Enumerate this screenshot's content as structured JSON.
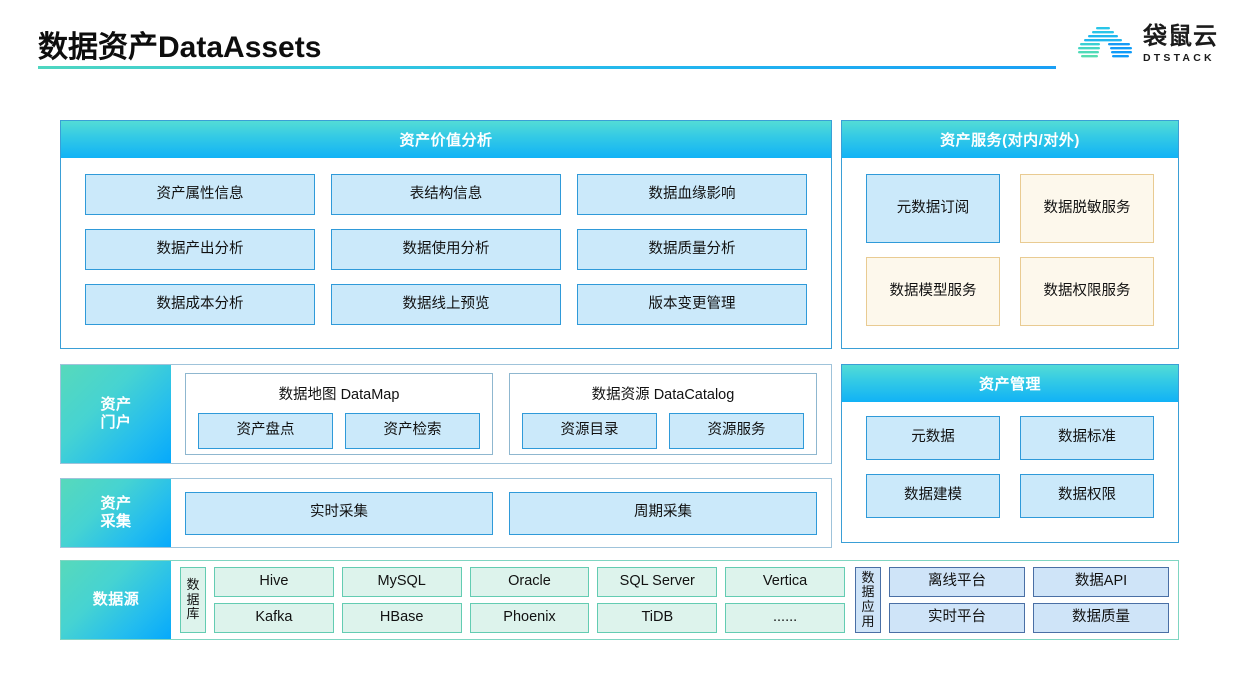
{
  "header": {
    "title": "数据资产DataAssets",
    "logo_cn": "袋鼠云",
    "logo_en": "DTSTACK",
    "logo_icon": "kangaroo-cloud-logo"
  },
  "colors": {
    "header_gradient_start": "#53dcd6",
    "header_gradient_end": "#11b2f6",
    "blue_fill": "#cbe9fa",
    "blue_border": "#2f9ad9",
    "cream_fill": "#fdf8ec",
    "cream_border": "#e9cb92",
    "mint_fill": "#ddf3ec",
    "mint_border": "#63ccb2",
    "app_fill": "#cfe4f8",
    "app_border": "#4a6fa5"
  },
  "value_analysis": {
    "title": "资产价值分析",
    "items": [
      {
        "label": "资产属性信息",
        "style": "blue"
      },
      {
        "label": "表结构信息",
        "style": "blue"
      },
      {
        "label": "数据血缘影响",
        "style": "blue"
      },
      {
        "label": "数据产出分析",
        "style": "blue"
      },
      {
        "label": "数据使用分析",
        "style": "blue"
      },
      {
        "label": "数据质量分析",
        "style": "blue"
      },
      {
        "label": "数据成本分析",
        "style": "blue"
      },
      {
        "label": "数据线上预览",
        "style": "blue"
      },
      {
        "label": "版本变更管理",
        "style": "blue"
      }
    ]
  },
  "asset_service": {
    "title": "资产服务(对内/对外)",
    "items": [
      {
        "label": "元数据订阅",
        "style": "blue"
      },
      {
        "label": "数据脱敏服务",
        "style": "cream"
      },
      {
        "label": "数据模型服务",
        "style": "cream"
      },
      {
        "label": "数据权限服务",
        "style": "cream"
      }
    ]
  },
  "asset_management": {
    "title": "资产管理",
    "items": [
      {
        "label": "元数据",
        "style": "blue"
      },
      {
        "label": "数据标准",
        "style": "blue"
      },
      {
        "label": "数据建模",
        "style": "blue"
      },
      {
        "label": "数据权限",
        "style": "blue"
      }
    ]
  },
  "asset_portal": {
    "label_line1": "资产",
    "label_line2": "门户",
    "groups": [
      {
        "title": "数据地图 DataMap",
        "items": [
          {
            "label": "资产盘点",
            "style": "blue"
          },
          {
            "label": "资产检索",
            "style": "blue"
          }
        ]
      },
      {
        "title": "数据资源 DataCatalog",
        "items": [
          {
            "label": "资源目录",
            "style": "blue"
          },
          {
            "label": "资源服务",
            "style": "blue"
          }
        ]
      }
    ]
  },
  "asset_collect": {
    "label_line1": "资产",
    "label_line2": "采集",
    "items": [
      {
        "label": "实时采集",
        "style": "blue"
      },
      {
        "label": "周期采集",
        "style": "blue"
      }
    ]
  },
  "data_source": {
    "label_line1": "数据源",
    "database": {
      "vertical_label": "数据库",
      "vertical_chars": [
        "数",
        "据",
        "库"
      ],
      "row1": [
        {
          "label": "Hive",
          "style": "mint"
        },
        {
          "label": "MySQL",
          "style": "mint"
        },
        {
          "label": "Oracle",
          "style": "mint"
        },
        {
          "label": "SQL Server",
          "style": "mint"
        },
        {
          "label": "Vertica",
          "style": "mint"
        }
      ],
      "row2": [
        {
          "label": "Kafka",
          "style": "mint"
        },
        {
          "label": "HBase",
          "style": "mint"
        },
        {
          "label": "Phoenix",
          "style": "mint"
        },
        {
          "label": "TiDB",
          "style": "mint"
        },
        {
          "label": "......",
          "style": "mint"
        }
      ]
    },
    "application": {
      "vertical_label": "数据应用",
      "vertical_chars": [
        "数",
        "据",
        "应",
        "用"
      ],
      "row1": [
        {
          "label": "离线平台",
          "style": "app"
        },
        {
          "label": "数据API",
          "style": "app"
        }
      ],
      "row2": [
        {
          "label": "实时平台",
          "style": "app"
        },
        {
          "label": "数据质量",
          "style": "app"
        }
      ]
    }
  }
}
